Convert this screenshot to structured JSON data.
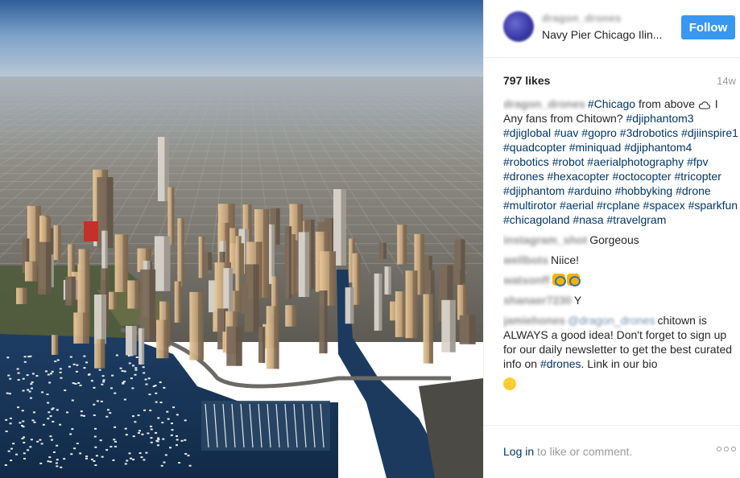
{
  "photo": {
    "subject": "Aerial view of Chicago skyline and lakefront"
  },
  "header": {
    "username": "dragon_drones",
    "location": "Navy Pier Chicago Ilin...",
    "follow_label": "Follow"
  },
  "stats": {
    "likes": "797 likes",
    "age": "14w"
  },
  "caption": {
    "author": "dragon_drones",
    "parts": [
      {
        "type": "tag",
        "text": "#Chicago"
      },
      {
        "type": "text",
        "text": " from above "
      },
      {
        "type": "icon",
        "name": "cloud-icon"
      },
      {
        "type": "text",
        "text": " I Any fans from Chitown? "
      },
      {
        "type": "tag",
        "text": "#djiphantom3"
      },
      {
        "type": "text",
        "text": " "
      },
      {
        "type": "tag",
        "text": "#djiglobal"
      },
      {
        "type": "text",
        "text": " "
      },
      {
        "type": "tag",
        "text": "#uav"
      },
      {
        "type": "text",
        "text": " "
      },
      {
        "type": "tag",
        "text": "#gopro"
      },
      {
        "type": "text",
        "text": " "
      },
      {
        "type": "tag",
        "text": "#3drobotics"
      },
      {
        "type": "text",
        "text": " "
      },
      {
        "type": "tag",
        "text": "#djiinspire1"
      },
      {
        "type": "text",
        "text": " "
      },
      {
        "type": "tag",
        "text": "#quadcopter"
      },
      {
        "type": "text",
        "text": " "
      },
      {
        "type": "tag",
        "text": "#miniquad"
      },
      {
        "type": "text",
        "text": " "
      },
      {
        "type": "tag",
        "text": "#djiphantom4"
      },
      {
        "type": "text",
        "text": " "
      },
      {
        "type": "tag",
        "text": "#robotics"
      },
      {
        "type": "text",
        "text": " "
      },
      {
        "type": "tag",
        "text": "#robot"
      },
      {
        "type": "text",
        "text": " "
      },
      {
        "type": "tag",
        "text": "#aerialphotography"
      },
      {
        "type": "text",
        "text": " "
      },
      {
        "type": "tag",
        "text": "#fpv"
      },
      {
        "type": "text",
        "text": " "
      },
      {
        "type": "tag",
        "text": "#drones"
      },
      {
        "type": "text",
        "text": " "
      },
      {
        "type": "tag",
        "text": "#hexacopter"
      },
      {
        "type": "text",
        "text": " "
      },
      {
        "type": "tag",
        "text": "#octocopter"
      },
      {
        "type": "text",
        "text": " "
      },
      {
        "type": "tag",
        "text": "#tricopter"
      },
      {
        "type": "text",
        "text": " "
      },
      {
        "type": "tag",
        "text": "#djiphantom"
      },
      {
        "type": "text",
        "text": " "
      },
      {
        "type": "tag",
        "text": "#arduino"
      },
      {
        "type": "text",
        "text": " "
      },
      {
        "type": "tag",
        "text": "#hobbyking"
      },
      {
        "type": "text",
        "text": " "
      },
      {
        "type": "tag",
        "text": "#drone"
      },
      {
        "type": "text",
        "text": " "
      },
      {
        "type": "tag",
        "text": "#multirotor"
      },
      {
        "type": "text",
        "text": " "
      },
      {
        "type": "tag",
        "text": "#aerial"
      },
      {
        "type": "text",
        "text": " "
      },
      {
        "type": "tag",
        "text": "#rcplane"
      },
      {
        "type": "text",
        "text": " "
      },
      {
        "type": "tag",
        "text": "#spacex"
      },
      {
        "type": "text",
        "text": " "
      },
      {
        "type": "tag",
        "text": "#sparkfun"
      },
      {
        "type": "text",
        "text": " "
      },
      {
        "type": "tag",
        "text": "#chicagoland"
      },
      {
        "type": "text",
        "text": " "
      },
      {
        "type": "tag",
        "text": "#nasa"
      },
      {
        "type": "text",
        "text": " "
      },
      {
        "type": "tag",
        "text": "#travelgram"
      }
    ]
  },
  "comments": [
    {
      "author": "instagram_shot",
      "text": "Gorgeous"
    },
    {
      "author": "wellbots",
      "text": "Niice!"
    },
    {
      "author": "watsonff",
      "text": "",
      "emoji": [
        "clap",
        "clap"
      ]
    },
    {
      "author": "shanaer7230",
      "text": "Y"
    },
    {
      "author": "jamiehones",
      "mention": "@dragon_drones",
      "text": "chitown is ALWAYS a good idea! Don't forget to sign up for our daily newsletter to get the best curated info on ",
      "tag": "#drones",
      "text_after": ". Link in our bio"
    },
    {
      "author": "",
      "text": "",
      "emoji": [
        "face"
      ]
    }
  ],
  "footer": {
    "login_link": "Log in",
    "login_rest": " to like or comment.",
    "more_icon": "ellipsis-icon"
  },
  "colors": {
    "follow_button": "#3897f0",
    "hashtag": "#003569",
    "muted": "#999999"
  }
}
